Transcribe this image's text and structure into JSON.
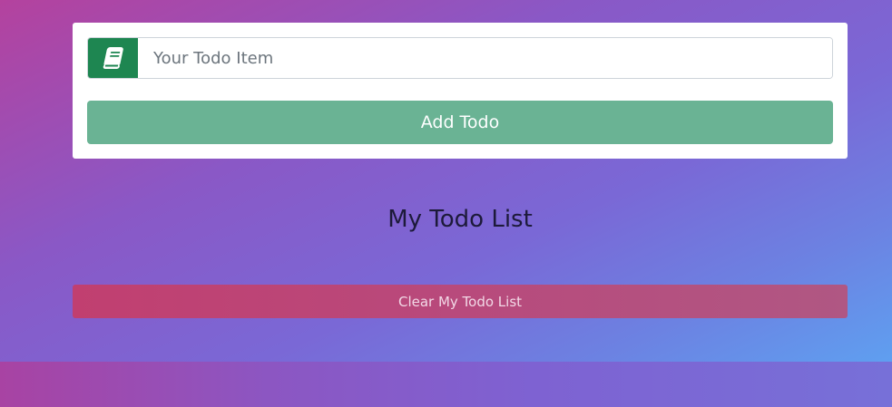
{
  "form": {
    "input_placeholder": "Your Todo Item",
    "input_value": "",
    "add_button_label": "Add Todo",
    "input_icon": "book-icon"
  },
  "list": {
    "title": "My Todo List",
    "items": []
  },
  "clear_button_label": "Clear My Todo List",
  "colors": {
    "icon_bg": "#1e8651",
    "add_button": "#6ab394",
    "clear_button": "#c13f70",
    "card": "#ffffff",
    "title_text": "#1d1a3a"
  }
}
